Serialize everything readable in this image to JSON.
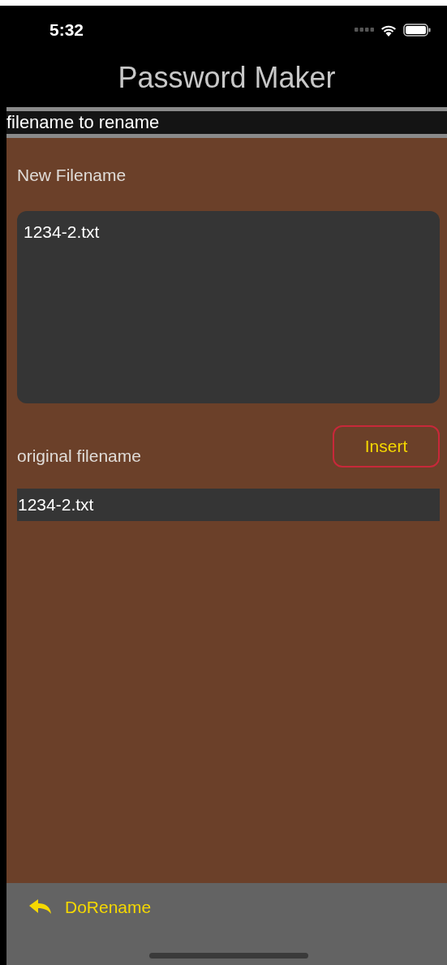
{
  "status_bar": {
    "time": "5:32"
  },
  "nav": {
    "title": "Password Maker"
  },
  "section_header": "filename to rename",
  "new_filename": {
    "label": "New Filename",
    "value": "1234-2.txt"
  },
  "insert_button": "Insert",
  "original_filename": {
    "label": "original filename",
    "value": "1234-2.txt"
  },
  "toolbar": {
    "button": "DoRename"
  }
}
